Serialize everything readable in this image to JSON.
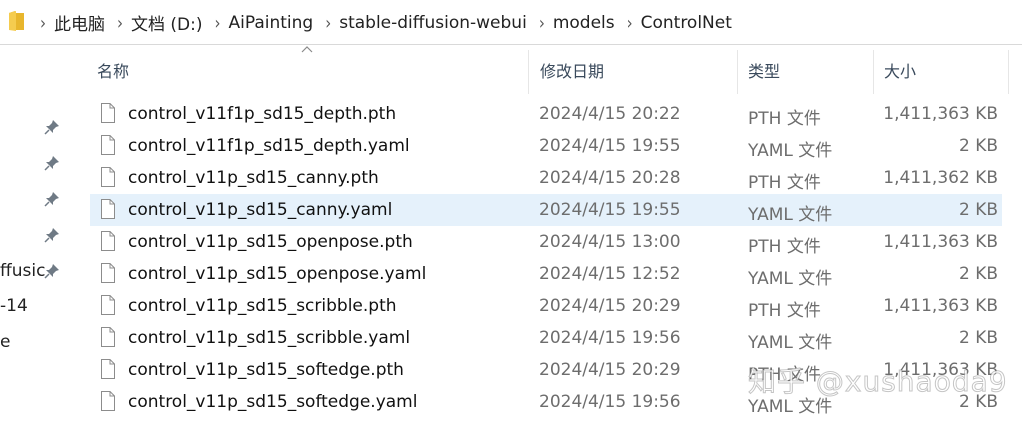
{
  "address_bar": {
    "crumbs": [
      "此电脑",
      "文档 (D:)",
      "AiPainting",
      "stable-diffusion-webui",
      "models",
      "ControlNet"
    ]
  },
  "columns": {
    "name": "名称",
    "modified": "修改日期",
    "type": "类型",
    "size": "大小"
  },
  "nav_fragments": [
    "ffusic",
    "-14",
    "e"
  ],
  "files": [
    {
      "name": "control_v11f1p_sd15_depth.pth",
      "modified": "2024/4/15 20:22",
      "type": "PTH 文件",
      "size": "1,411,363 KB",
      "selected": false
    },
    {
      "name": "control_v11f1p_sd15_depth.yaml",
      "modified": "2024/4/15 19:55",
      "type": "YAML 文件",
      "size": "2 KB",
      "selected": false
    },
    {
      "name": "control_v11p_sd15_canny.pth",
      "modified": "2024/4/15 20:28",
      "type": "PTH 文件",
      "size": "1,411,362 KB",
      "selected": false
    },
    {
      "name": "control_v11p_sd15_canny.yaml",
      "modified": "2024/4/15 19:55",
      "type": "YAML 文件",
      "size": "2 KB",
      "selected": true
    },
    {
      "name": "control_v11p_sd15_openpose.pth",
      "modified": "2024/4/15 13:00",
      "type": "PTH 文件",
      "size": "1,411,363 KB",
      "selected": false
    },
    {
      "name": "control_v11p_sd15_openpose.yaml",
      "modified": "2024/4/15 12:52",
      "type": "YAML 文件",
      "size": "2 KB",
      "selected": false
    },
    {
      "name": "control_v11p_sd15_scribble.pth",
      "modified": "2024/4/15 20:29",
      "type": "PTH 文件",
      "size": "1,411,363 KB",
      "selected": false
    },
    {
      "name": "control_v11p_sd15_scribble.yaml",
      "modified": "2024/4/15 19:56",
      "type": "YAML 文件",
      "size": "2 KB",
      "selected": false
    },
    {
      "name": "control_v11p_sd15_softedge.pth",
      "modified": "2024/4/15 20:29",
      "type": "PTH 文件",
      "size": "1,411,363 KB",
      "selected": false
    },
    {
      "name": "control_v11p_sd15_softedge.yaml",
      "modified": "2024/4/15 19:56",
      "type": "YAML 文件",
      "size": "2 KB",
      "selected": false
    }
  ],
  "watermark": "知乎 @xushaoda9",
  "colors": {
    "selected_row": "#e5f1fb",
    "header_text": "#3a4a5c",
    "folder_yellow": "#e8b62d"
  },
  "icons": {
    "folder": "folder-icon",
    "file": "file-icon",
    "pin": "pin-icon",
    "breadcrumb_separator": "chevron-right-icon",
    "sort": "sort-up-icon"
  }
}
